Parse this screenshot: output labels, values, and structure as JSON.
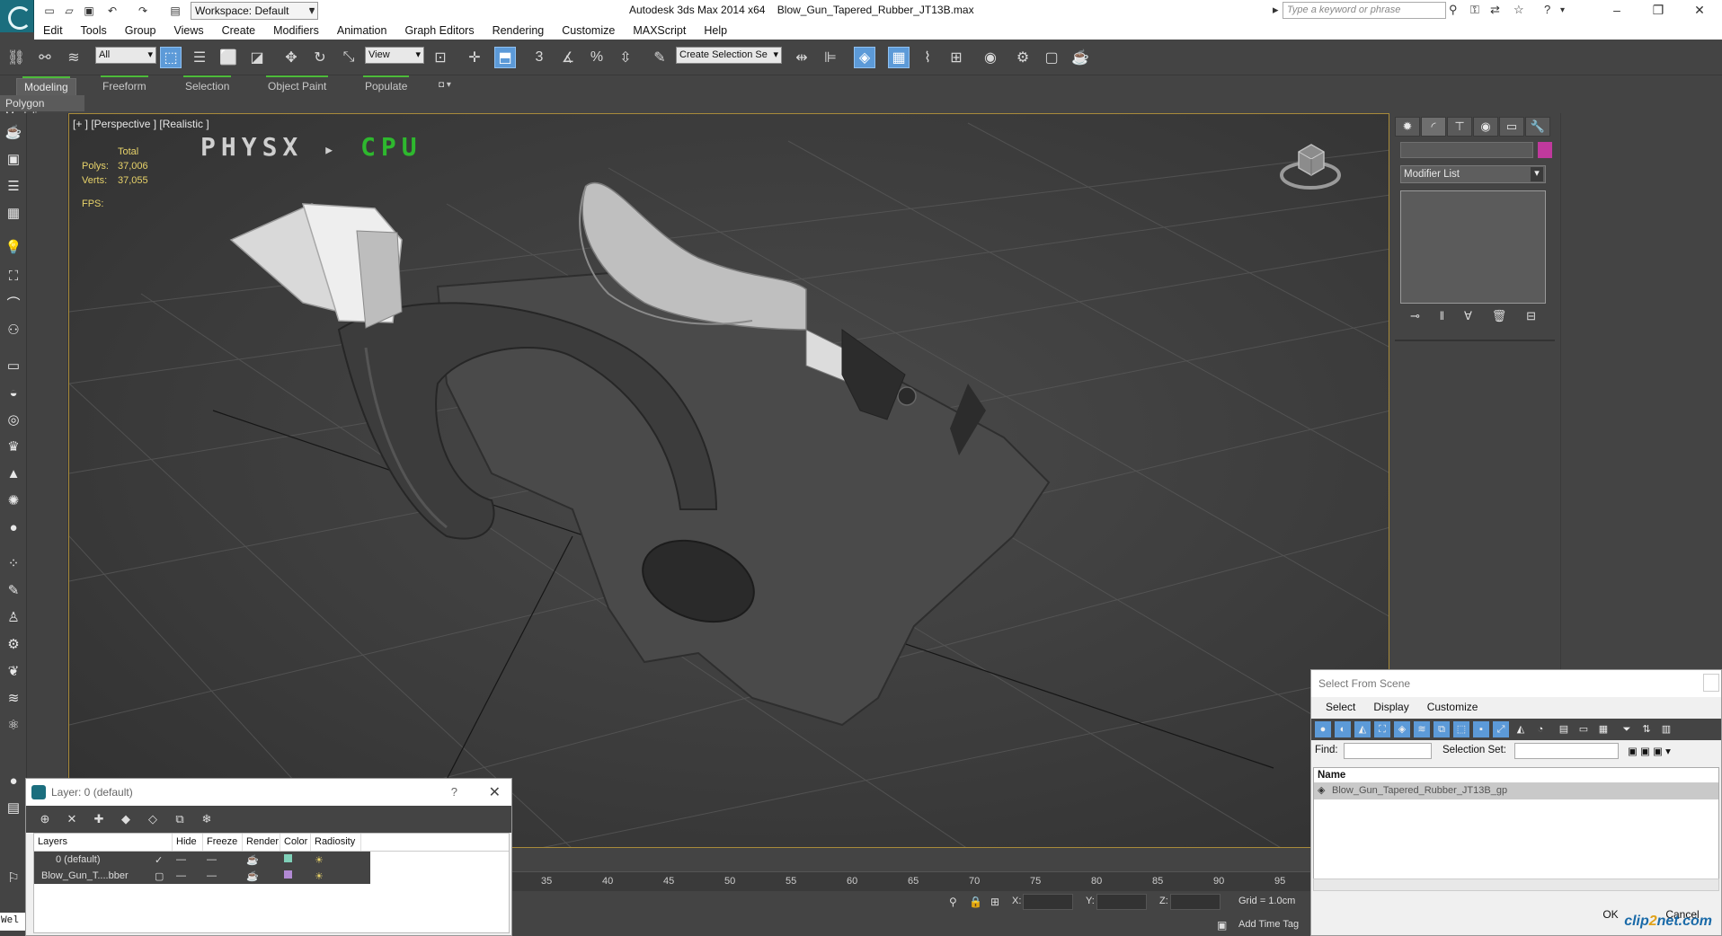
{
  "titlebar": {
    "workspace": "Workspace: Default",
    "app_name": "Autodesk 3ds Max  2014 x64",
    "file_name": "Blow_Gun_Tapered_Rubber_JT13B.max",
    "search_placeholder": "Type a keyword or phrase"
  },
  "menu": [
    "Edit",
    "Tools",
    "Group",
    "Views",
    "Create",
    "Modifiers",
    "Animation",
    "Graph Editors",
    "Rendering",
    "Customize",
    "MAXScript",
    "Help"
  ],
  "toolbar": {
    "selection_filter": "All",
    "ref_coord": "View",
    "named_selection": "Create Selection Se"
  },
  "ribbon": {
    "tabs": [
      "Modeling",
      "Freeform",
      "Selection",
      "Object Paint",
      "Populate"
    ],
    "panel_label": "Polygon Modeling"
  },
  "viewport": {
    "label": "[+ ] [Perspective ] [Realistic ]",
    "stats_header": "Total",
    "polys_label": "Polys:",
    "polys_value": "37,006",
    "verts_label": "Verts:",
    "verts_value": "37,055",
    "fps_label": "FPS:",
    "physx_a": "PHYSX",
    "physx_b": "CPU"
  },
  "command_panel": {
    "modifier_list": "Modifier List",
    "object_color": "#c0399d"
  },
  "layer_dialog": {
    "title": "Layer: 0 (default)",
    "help": "?",
    "columns": [
      "Layers",
      "Hide",
      "Freeze",
      "Render",
      "Color",
      "Radiosity"
    ],
    "rows": [
      {
        "name": "0 (default)",
        "color": "#7fd0b8"
      },
      {
        "name": "Blow_Gun_T....bber",
        "color": "#b28ad4"
      }
    ]
  },
  "timeline": {
    "ticks": [
      "35",
      "40",
      "45",
      "50",
      "55",
      "60",
      "65",
      "70",
      "75",
      "80",
      "85",
      "90",
      "95"
    ]
  },
  "status": {
    "x_label": "X:",
    "y_label": "Y:",
    "z_label": "Z:",
    "grid": "Grid = 1.0cm",
    "add_time_tag": "Add Time Tag",
    "welcome": "Wel"
  },
  "select_scene": {
    "title": "Select From Scene",
    "menu": [
      "Select",
      "Display",
      "Customize"
    ],
    "find_label": "Find:",
    "selset_label": "Selection Set:",
    "column_name": "Name",
    "items": [
      "Blow_Gun_Tapered_Rubber_JT13B_gp"
    ],
    "ok": "OK",
    "cancel": "Cancel",
    "watermark_a": "clip",
    "watermark_b": "2",
    "watermark_c": "net.com"
  }
}
